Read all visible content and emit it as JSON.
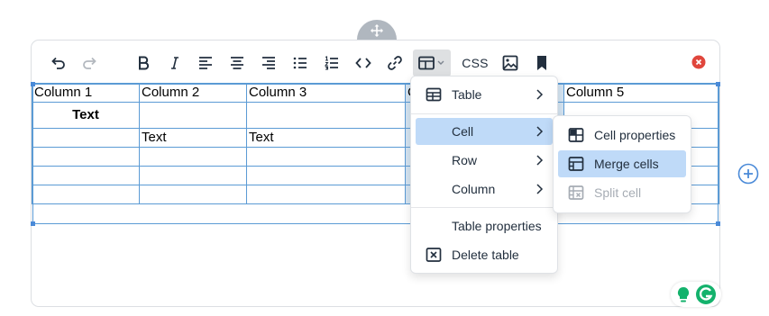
{
  "toolbar": {
    "css_label": "CSS"
  },
  "table": {
    "rows": [
      [
        "Column 1",
        "Column 2",
        "Column 3",
        "C",
        "Column 5"
      ],
      [
        "Text",
        "",
        "",
        "",
        ""
      ],
      [
        "",
        "Text",
        "Text",
        "",
        ""
      ],
      [
        "",
        "",
        "",
        "",
        ""
      ],
      [
        "",
        "",
        "",
        "",
        ""
      ],
      [
        "",
        "",
        "",
        "",
        ""
      ]
    ]
  },
  "menu": {
    "table": "Table",
    "cell": "Cell",
    "row": "Row",
    "column": "Column",
    "table_properties": "Table properties",
    "delete_table": "Delete table"
  },
  "submenu": {
    "cell_properties": "Cell properties",
    "merge_cells": "Merge cells",
    "split_cell": "Split cell"
  },
  "colors": {
    "accent": "#4a8ad8",
    "highlight": "#bfdaf8",
    "close": "#e0463c",
    "grammarly": "#14b26c"
  }
}
